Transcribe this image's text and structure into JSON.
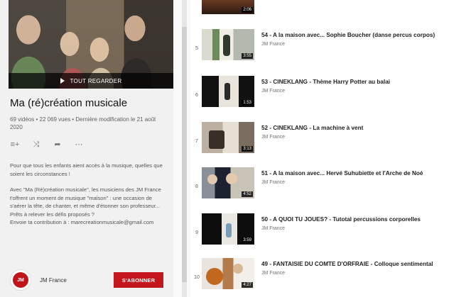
{
  "playlist": {
    "hero_button": "TOUT REGARDER",
    "title": "Ma (ré)création musicale",
    "meta": "69 vidéos • 22 069 vues • Dernière modification le 21 août 2020",
    "description": [
      "Pour que tous les enfants aient accès à la musique, quelles que soient les circonstances !",
      "Avec \"Ma (Ré)création musicale\", les musiciens des JM France t'offrent un moment de musique \"maison\" : une occasion de s'aérer la tête, de chanter, et même d'étonner son professeur... Prêts à relever les défis proposés ?",
      "Envoie ta contribution à : marecreationmusicale@gmail.com"
    ],
    "owner_name": "JM France",
    "avatar_text": "JM",
    "subscribe_label": "S'ABONNER"
  },
  "icons": {
    "add_to_queue": "playlist-add-icon",
    "shuffle": "shuffle-icon",
    "share": "share-icon",
    "more": "more-icon"
  },
  "videos": [
    {
      "index": "5",
      "title": "54 - A la maison avec... Sophie Boucher (danse percus corpos)",
      "channel": "JM France",
      "duration": "3:55"
    },
    {
      "index": "6",
      "title": "53 - CINEKLANG - Thème Harry Potter au balai",
      "channel": "JM France",
      "duration": "1:53"
    },
    {
      "index": "7",
      "title": "52 - CINEKLANG - La machine à vent",
      "channel": "JM France",
      "duration": "3:13"
    },
    {
      "index": "8",
      "title": "51 - A la maison avec... Hervé Suhubiette et l'Arche de Noé",
      "channel": "JM France",
      "duration": "4:52"
    },
    {
      "index": "9",
      "title": "50 - A QUOI TU JOUES? - Tutotal percussions corporelles",
      "channel": "JM France",
      "duration": "3:59"
    },
    {
      "index": "10",
      "title": "49 - FANTAISIE DU COMTE D'ORFRAIE - Colloque sentimental",
      "channel": "JM France",
      "duration": "4:27"
    }
  ],
  "top_partial_duration": "2:06"
}
